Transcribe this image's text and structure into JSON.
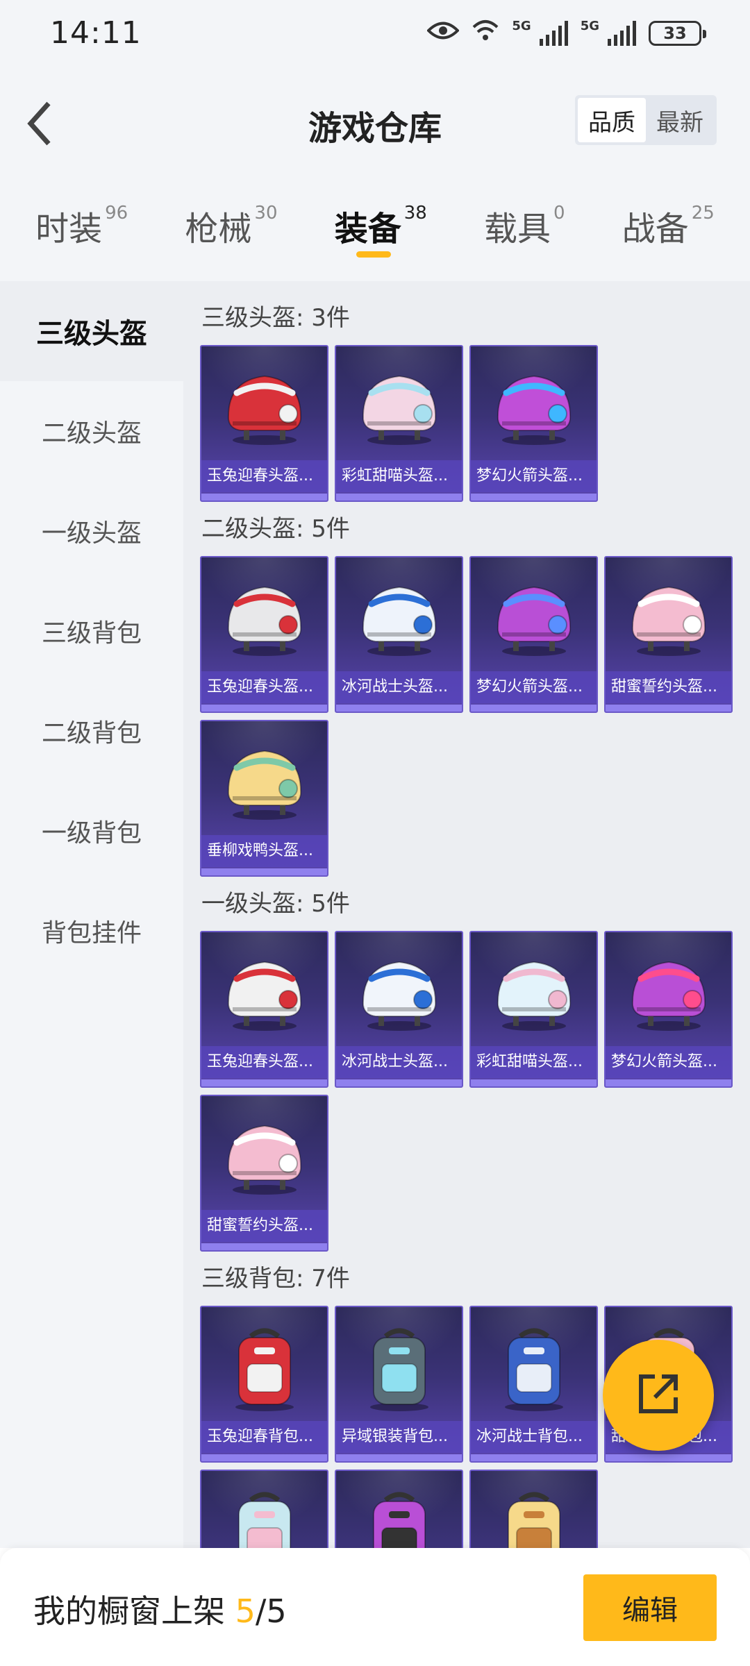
{
  "status_bar": {
    "time": "14:11",
    "network1": "5G",
    "network2": "5G",
    "battery": "33"
  },
  "header": {
    "title": "游戏仓库",
    "sort_options": [
      {
        "label": "品质",
        "active": true
      },
      {
        "label": "最新",
        "active": false
      }
    ]
  },
  "tabs": [
    {
      "label": "时装",
      "count": "96",
      "active": false
    },
    {
      "label": "枪械",
      "count": "30",
      "active": false
    },
    {
      "label": "装备",
      "count": "38",
      "active": true
    },
    {
      "label": "载具",
      "count": "0",
      "active": false
    },
    {
      "label": "战备",
      "count": "25",
      "active": false
    }
  ],
  "sidebar": {
    "items": [
      {
        "label": "三级头盔",
        "active": true
      },
      {
        "label": "二级头盔",
        "active": false
      },
      {
        "label": "一级头盔",
        "active": false
      },
      {
        "label": "三级背包",
        "active": false
      },
      {
        "label": "二级背包",
        "active": false
      },
      {
        "label": "一级背包",
        "active": false
      },
      {
        "label": "背包挂件",
        "active": false
      }
    ]
  },
  "sections": [
    {
      "title": "三级头盔: 3件",
      "items": [
        {
          "name": "玉兔迎春头盔...",
          "icon": "helmet-icon",
          "color": "#d9323a",
          "accent": "#f2f2f2"
        },
        {
          "name": "彩虹甜喵头盔...",
          "icon": "helmet-icon",
          "color": "#f3d6e4",
          "accent": "#a8e0f0"
        },
        {
          "name": "梦幻火箭头盔...",
          "icon": "helmet-icon",
          "color": "#c04fd8",
          "accent": "#3fb7ff"
        }
      ]
    },
    {
      "title": "二级头盔: 5件",
      "items": [
        {
          "name": "玉兔迎春头盔...",
          "icon": "helmet-icon",
          "color": "#e8e8ea",
          "accent": "#d9323a"
        },
        {
          "name": "冰河战士头盔...",
          "icon": "helmet-icon",
          "color": "#eef3fb",
          "accent": "#2c6fd6"
        },
        {
          "name": "梦幻火箭头盔...",
          "icon": "helmet-icon",
          "color": "#b94fd6",
          "accent": "#5a8fff"
        },
        {
          "name": "甜蜜誓约头盔...",
          "icon": "helmet-icon",
          "color": "#f4bcd0",
          "accent": "#ffffff"
        },
        {
          "name": "垂柳戏鸭头盔...",
          "icon": "helmet-icon",
          "color": "#f6d98a",
          "accent": "#7ec9a8"
        }
      ]
    },
    {
      "title": "一级头盔: 5件",
      "items": [
        {
          "name": "玉兔迎春头盔...",
          "icon": "helmet-icon",
          "color": "#f1f1f1",
          "accent": "#d9323a"
        },
        {
          "name": "冰河战士头盔...",
          "icon": "helmet-icon",
          "color": "#f1f5fb",
          "accent": "#2c6fd6"
        },
        {
          "name": "彩虹甜喵头盔...",
          "icon": "helmet-icon",
          "color": "#e3f3fb",
          "accent": "#f0b8d0"
        },
        {
          "name": "梦幻火箭头盔...",
          "icon": "helmet-icon",
          "color": "#b94fd6",
          "accent": "#ff4d8d"
        },
        {
          "name": "甜蜜誓约头盔...",
          "icon": "helmet-icon",
          "color": "#f4bcd0",
          "accent": "#ffffff"
        }
      ]
    },
    {
      "title": "三级背包: 7件",
      "items": [
        {
          "name": "玉兔迎春背包...",
          "icon": "backpack-icon",
          "color": "#d9323a",
          "accent": "#f2f2f2"
        },
        {
          "name": "异域银装背包...",
          "icon": "backpack-icon",
          "color": "#5a6e78",
          "accent": "#8fe0f0"
        },
        {
          "name": "冰河战士背包...",
          "icon": "backpack-icon",
          "color": "#3a64c8",
          "accent": "#e8eef8"
        },
        {
          "name": "甜蜜誓约背包...",
          "icon": "backpack-icon",
          "color": "#f4bcd0",
          "accent": "#ffffff"
        },
        {
          "name": "",
          "icon": "backpack-icon",
          "color": "#c8e8f0",
          "accent": "#f4bcd0"
        },
        {
          "name": "",
          "icon": "backpack-icon",
          "color": "#b94fd6",
          "accent": "#333333"
        },
        {
          "name": "",
          "icon": "backpack-icon",
          "color": "#f6d98a",
          "accent": "#c8803a"
        }
      ]
    }
  ],
  "fab": {
    "icon": "share-icon"
  },
  "bottom_bar": {
    "prefix": "我的橱窗上架 ",
    "current": "5",
    "total": "/5",
    "edit_label": "编辑"
  },
  "colors": {
    "accent": "#ffb91a",
    "card_bg": "#3a3276",
    "card_label_bg": "#5846be"
  }
}
